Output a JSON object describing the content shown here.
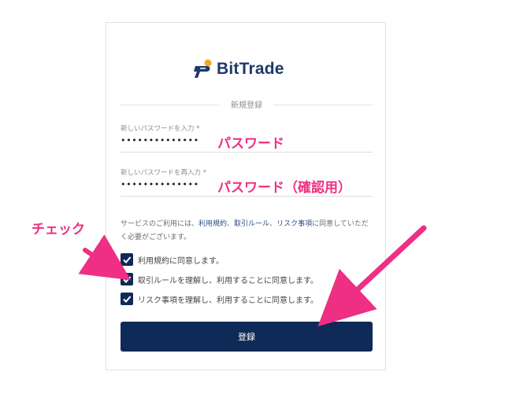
{
  "brand": {
    "name": "BitTrade"
  },
  "form": {
    "section_title": "新規登録",
    "password": {
      "label": "新しいパスワードを入力 *",
      "value": "••••••••••••••"
    },
    "password_confirm": {
      "label": "新しいパスワードを再入力 *",
      "value": "••••••••••••••"
    },
    "notice": {
      "prefix": "サービスのご利用には、",
      "link_terms": "利用規約",
      "sep1": "、",
      "link_trading_rules": "取引ルール",
      "sep2": "、",
      "link_risk": "リスク事項",
      "suffix": "に同意していただく必要がございます。"
    },
    "checkboxes": [
      {
        "label": "利用規約に同意します。",
        "checked": true
      },
      {
        "label": "取引ルールを理解し、利用することに同意します。",
        "checked": true
      },
      {
        "label": "リスク事項を理解し、利用することに同意します。",
        "checked": true
      }
    ],
    "submit_label": "登録"
  },
  "annotations": {
    "password": "パスワード",
    "password_confirm": "パスワード（確認用）",
    "check": "チェック"
  },
  "colors": {
    "navy": "#0f2a57",
    "brand_orange": "#f5a623",
    "annotation_pink": "#ee2f83"
  }
}
